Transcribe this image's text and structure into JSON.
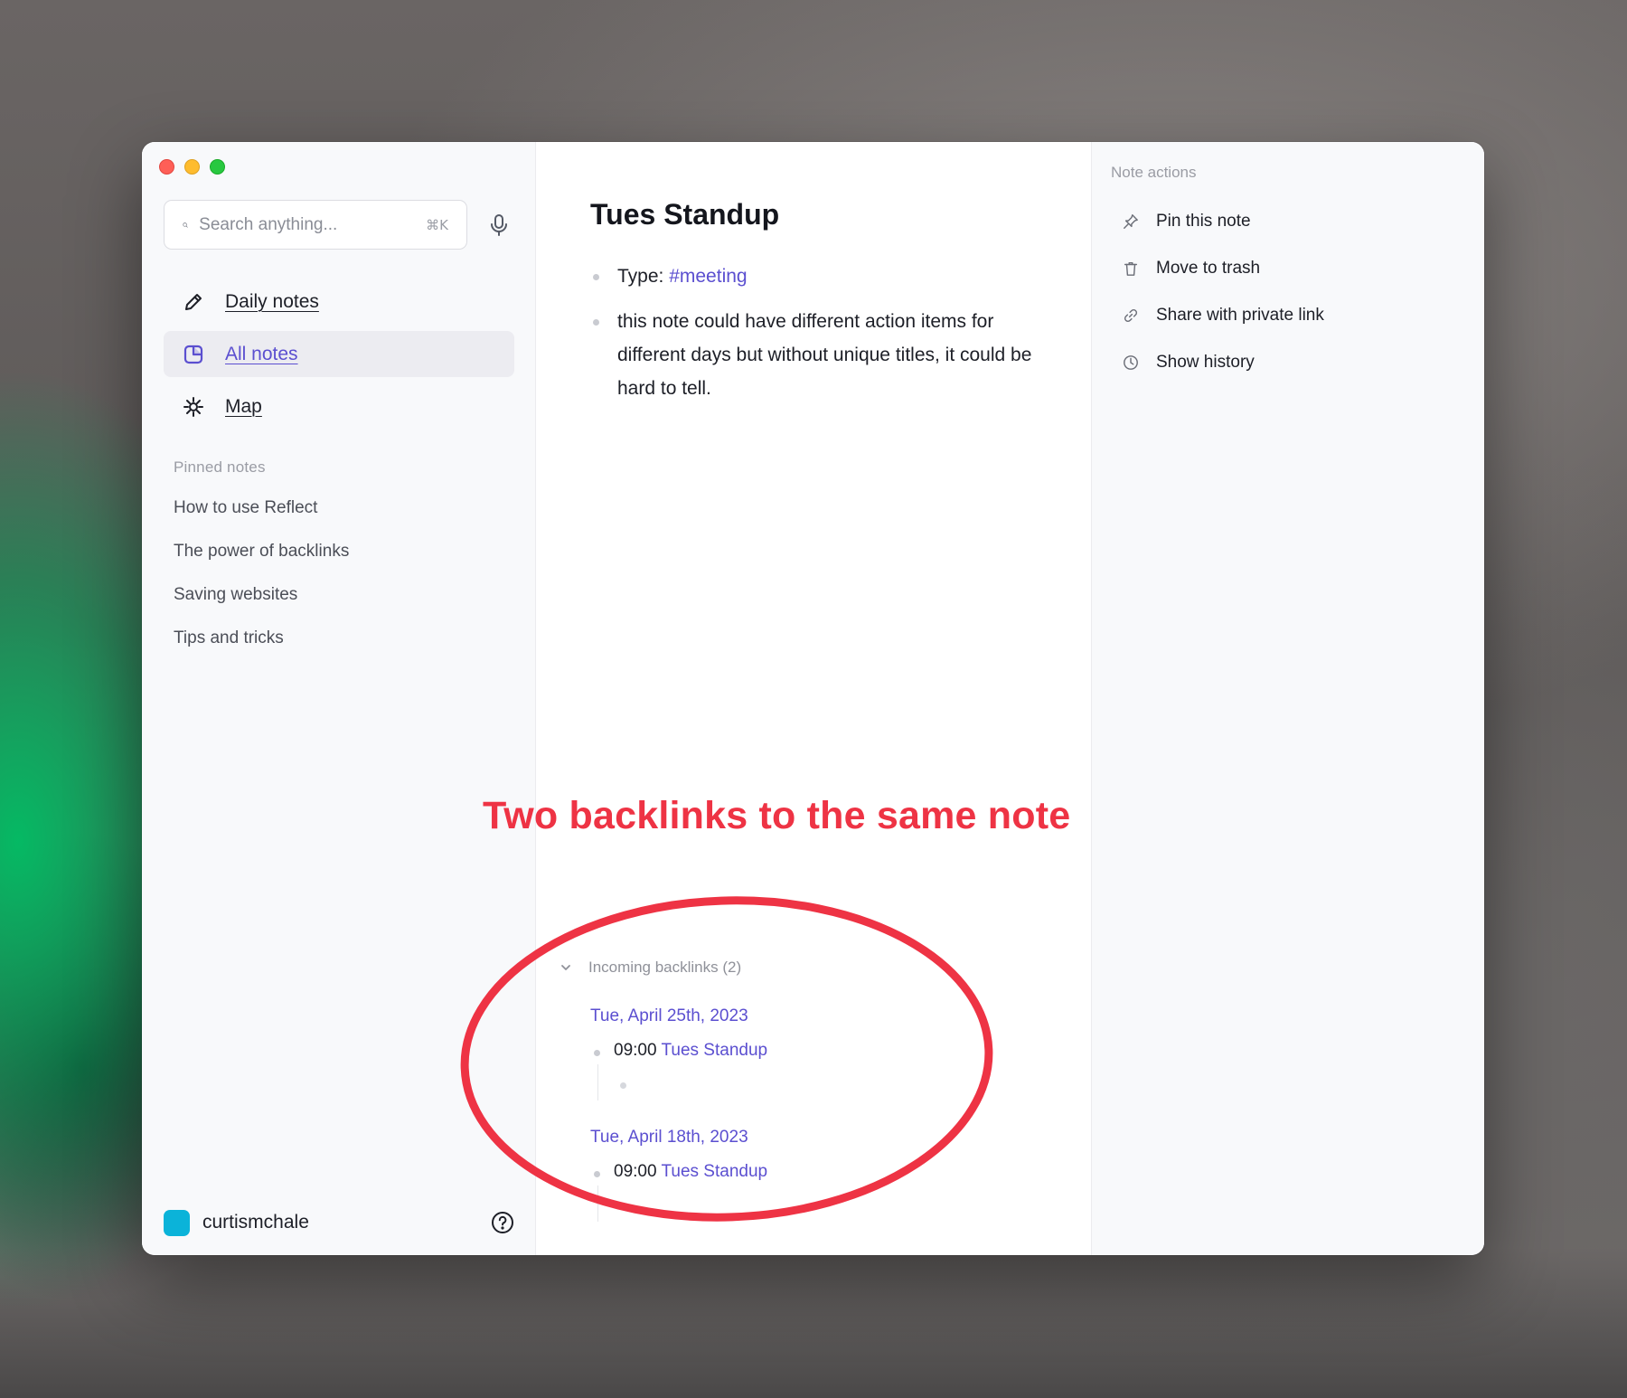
{
  "search": {
    "placeholder": "Search anything...",
    "shortcut": "⌘K"
  },
  "nav": [
    {
      "label": "Daily notes",
      "icon": "pencil-icon",
      "active": false
    },
    {
      "label": "All notes",
      "icon": "note-icon",
      "active": true
    },
    {
      "label": "Map",
      "icon": "map-icon",
      "active": false
    }
  ],
  "pinned": {
    "heading": "Pinned notes",
    "items": [
      "How to use Reflect",
      "The power of backlinks",
      "Saving websites",
      "Tips and tricks"
    ]
  },
  "user": {
    "name": "curtismchale",
    "avatar_color": "#0bb3d9"
  },
  "note": {
    "title": "Tues Standup",
    "type_label": "Type: ",
    "type_tag": "#meeting",
    "body_text": "this note could have different action items for different days but without unique titles, it could be hard to tell."
  },
  "backlinks": {
    "heading": "Incoming backlinks (2)",
    "groups": [
      {
        "date": "Tue, April 25th, 2023",
        "time": "09:00 ",
        "link": "Tues Standup"
      },
      {
        "date": "Tue, April 18th, 2023",
        "time": "09:00 ",
        "link": "Tues Standup"
      }
    ]
  },
  "actions": {
    "heading": "Note actions",
    "items": [
      {
        "label": "Pin this note",
        "icon": "pin-icon"
      },
      {
        "label": "Move to trash",
        "icon": "trash-icon"
      },
      {
        "label": "Share with private link",
        "icon": "link-icon"
      },
      {
        "label": "Show history",
        "icon": "clock-icon"
      }
    ]
  },
  "annotation": {
    "text": "Two backlinks to the same note",
    "color": "#ee3344"
  },
  "colors": {
    "accent": "#5b4fd0",
    "traffic_close": "#fe5f57",
    "traffic_min": "#febc2e",
    "traffic_max": "#28c840"
  }
}
